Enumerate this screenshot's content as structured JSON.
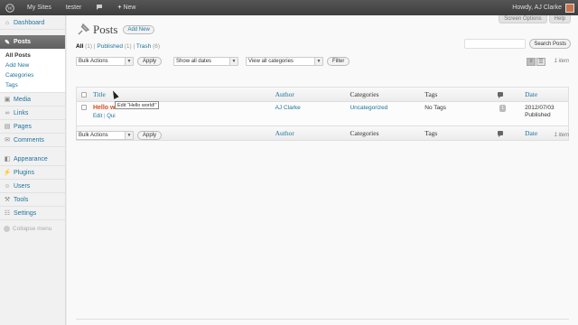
{
  "adminbar": {
    "wp_logo_icon": "wordpress-logo-icon",
    "my_sites": "My Sites",
    "site_name": "tester",
    "comments_icon": "speech-bubble-icon",
    "new_label": "New",
    "greeting": "Howdy, AJ Clarke"
  },
  "sidebar": {
    "dashboard": "Dashboard",
    "posts": "Posts",
    "posts_sub": [
      "All Posts",
      "Add New",
      "Categories",
      "Tags"
    ],
    "media": "Media",
    "links": "Links",
    "pages": "Pages",
    "comments": "Comments",
    "appearance": "Appearance",
    "plugins": "Plugins",
    "users": "Users",
    "tools": "Tools",
    "settings": "Settings",
    "collapse": "Collapse menu"
  },
  "header": {
    "screen_options": "Screen Options",
    "help": "Help",
    "title": "Posts",
    "add_new": "Add New"
  },
  "filters": {
    "all": "All",
    "all_count": "(1)",
    "published": "Published",
    "published_count": "(1)",
    "trash": "Trash",
    "trash_count": "(6)"
  },
  "search": {
    "button": "Search Posts",
    "value": ""
  },
  "tablenav_top": {
    "bulk_actions": "Bulk Actions",
    "apply": "Apply",
    "dates": "Show all dates",
    "categories": "View all categories",
    "filter": "Filter",
    "items": "1 item"
  },
  "tablenav_bottom": {
    "bulk_actions": "Bulk Actions",
    "apply": "Apply",
    "items": "1 item"
  },
  "table": {
    "columns": {
      "title": "Title",
      "author": "Author",
      "categories": "Categories",
      "tags": "Tags",
      "date": "Date"
    },
    "rows": [
      {
        "title": "Hello world!",
        "actions": {
          "edit": "Edit",
          "quick": "Qui"
        },
        "author": "AJ Clarke",
        "categories": "Uncategorized",
        "tags": "No Tags",
        "comments": "1",
        "date": "2012/07/03",
        "status": "Published"
      }
    ]
  },
  "tooltip": "Edit “Hello world!”"
}
